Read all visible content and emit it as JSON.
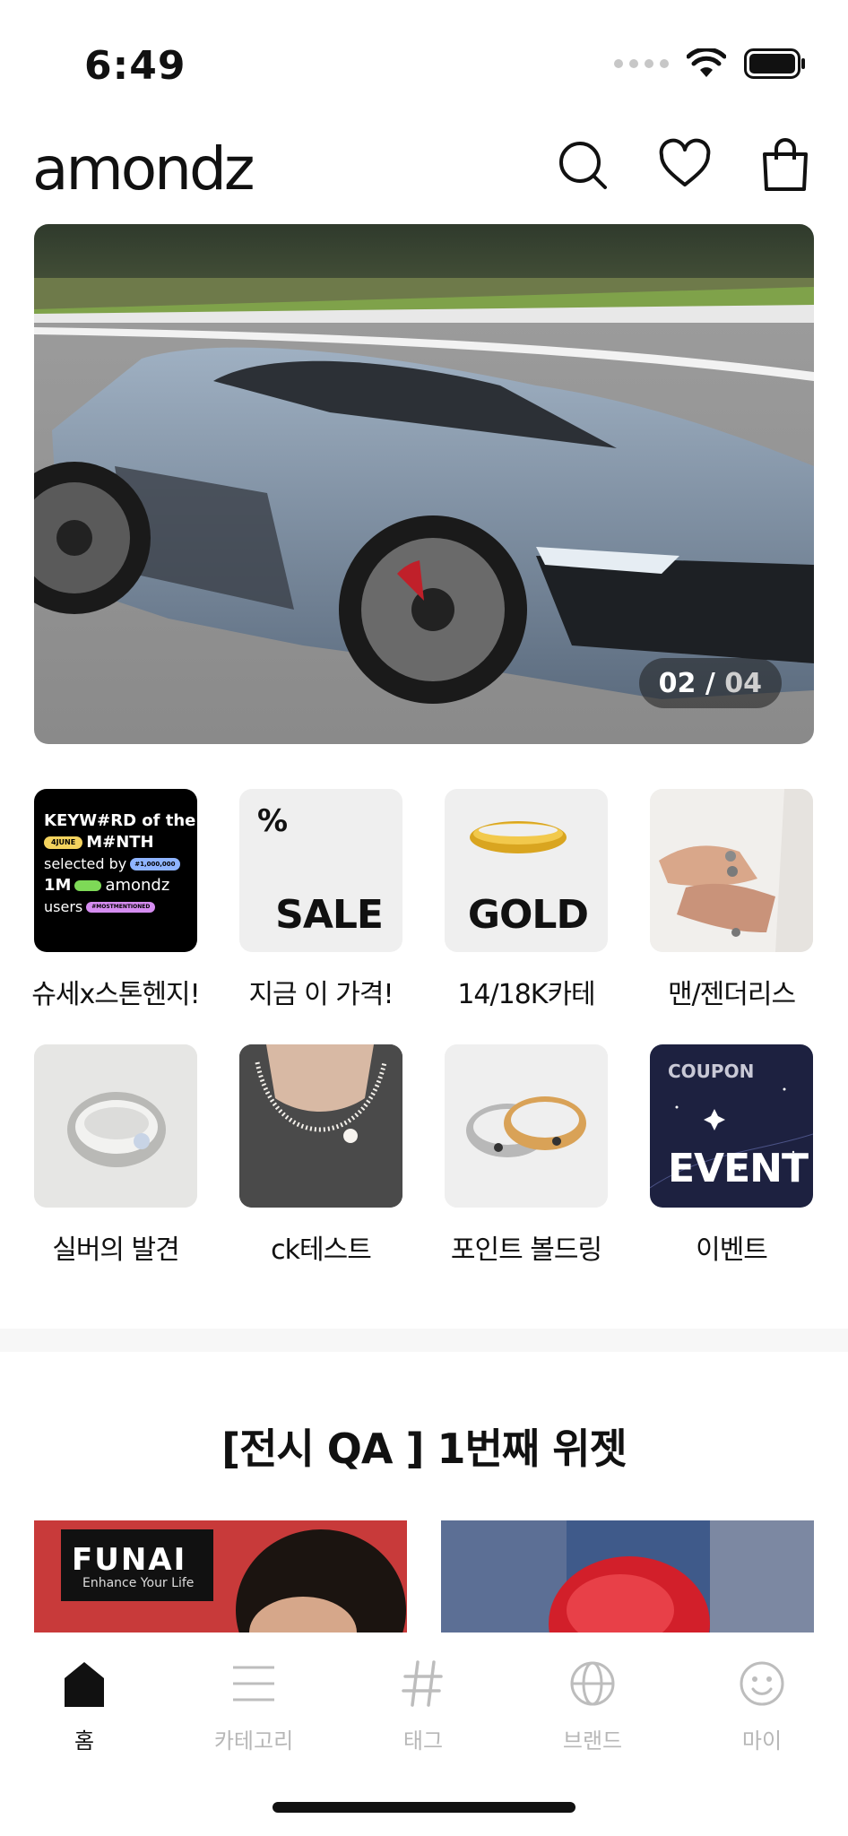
{
  "status": {
    "time": "6:49"
  },
  "header": {
    "logo": "amondz"
  },
  "hero": {
    "current": "02",
    "separator": " / ",
    "total": "04"
  },
  "categories": [
    {
      "label": "슈세x스톤헨지!",
      "thumb": "keyword-banner",
      "lines": [
        "KEYW#RD of the",
        "M#NTH",
        "selected by",
        "1M",
        "amondz",
        "users"
      ],
      "chips": [
        "4JUNE",
        "#1,000,000",
        "#MOSTMENTIONED"
      ]
    },
    {
      "label": "지금 이 가격!",
      "thumb": "sale",
      "tag": "%",
      "word": "SALE"
    },
    {
      "label": "14/18K카테",
      "thumb": "gold",
      "word": "GOLD"
    },
    {
      "label": "맨/젠더리스",
      "thumb": "hands-rings"
    },
    {
      "label": "실버의 발견",
      "thumb": "silver-ring"
    },
    {
      "label": "ck테스트",
      "thumb": "pearl-necklace"
    },
    {
      "label": "포인트 볼드링",
      "thumb": "bold-rings"
    },
    {
      "label": "이벤트",
      "thumb": "event",
      "tag": "COUPON",
      "word": "EVENT"
    }
  ],
  "widget": {
    "title": "[전시 QA ] 1번째 위젯",
    "card1_sign": "FUNAI",
    "card1_sub": "Enhance Your Life"
  },
  "tabs": [
    {
      "label": "홈",
      "icon": "home-icon",
      "active": true
    },
    {
      "label": "카테고리",
      "icon": "menu-icon",
      "active": false
    },
    {
      "label": "태그",
      "icon": "hashtag-icon",
      "active": false
    },
    {
      "label": "브랜드",
      "icon": "globe-icon",
      "active": false
    },
    {
      "label": "마이",
      "icon": "smiley-icon",
      "active": false
    }
  ],
  "colors": {
    "text": "#111111",
    "muted": "#b7b7b7",
    "event_bg": "#1d2140",
    "chip_yellow": "#f4d35e",
    "chip_green": "#7ed957",
    "chip_blue": "#8fb4ff",
    "chip_pink": "#d58cf0"
  }
}
